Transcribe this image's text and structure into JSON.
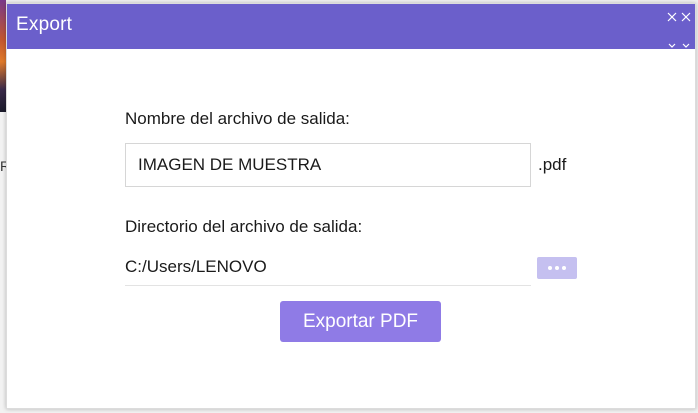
{
  "dialog": {
    "title": "Export",
    "close_icon": "close-icon",
    "filename_label": "Nombre del archivo de salida:",
    "filename_value": "IMAGEN DE MUESTRA",
    "extension": ".pdf",
    "directory_label": "Directorio del archivo de salida:",
    "directory_value": "C:/Users/LENOVO",
    "browse_icon": "more-horizontal-icon",
    "export_button_label": "Exportar PDF"
  },
  "background": {
    "partial_char": "R"
  },
  "colors": {
    "titlebar": "#6b5fcb",
    "export_button": "#8f7be6",
    "browse_button": "#c5c0f0"
  }
}
